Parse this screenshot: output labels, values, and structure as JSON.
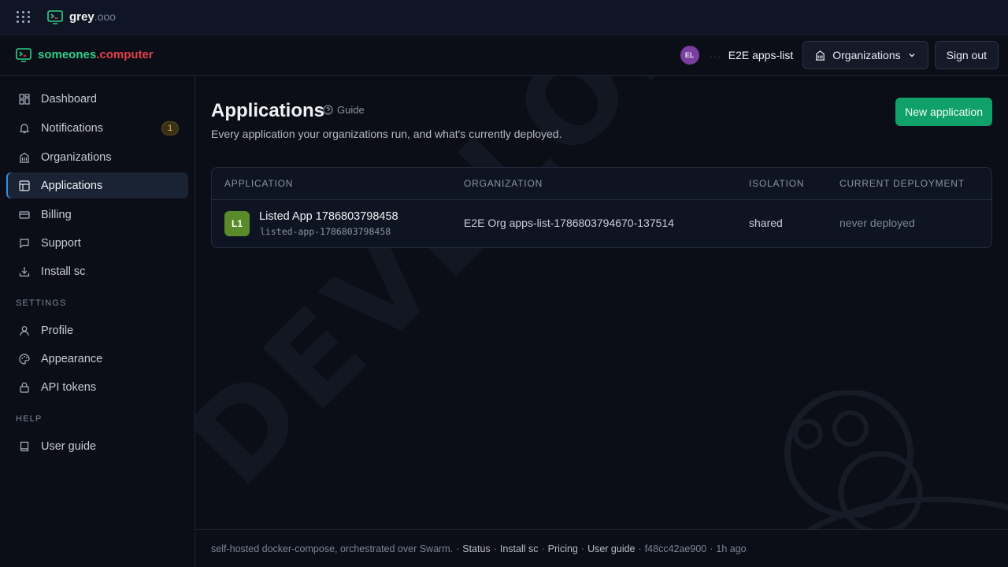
{
  "topbar": {
    "brand": "grey",
    "brand_tld": ".ooo"
  },
  "header": {
    "brand_part1": "someones",
    "brand_part2": ".computer",
    "avatar_initials": "EL",
    "context_dots": "...",
    "context_name": "E2E apps-list",
    "org_button": "Organizations",
    "signout": "Sign out"
  },
  "sidebar": {
    "items": [
      {
        "label": "Dashboard",
        "icon": "dashboard-icon"
      },
      {
        "label": "Notifications",
        "icon": "bell-icon",
        "badge": "1"
      },
      {
        "label": "Organizations",
        "icon": "building-icon"
      },
      {
        "label": "Applications",
        "icon": "layout-icon",
        "active": true
      },
      {
        "label": "Billing",
        "icon": "credit-card-icon"
      },
      {
        "label": "Support",
        "icon": "chat-icon"
      },
      {
        "label": "Install sc",
        "icon": "download-icon"
      }
    ],
    "settings_title": "SETTINGS",
    "settings_items": [
      {
        "label": "Profile",
        "icon": "user-icon"
      },
      {
        "label": "Appearance",
        "icon": "palette-icon"
      },
      {
        "label": "API tokens",
        "icon": "lock-icon"
      }
    ],
    "help_title": "HELP",
    "help_items": [
      {
        "label": "User guide",
        "icon": "book-icon"
      }
    ]
  },
  "main": {
    "title": "Applications",
    "guide": "Guide",
    "subtitle": "Every application your organizations run, and what's currently deployed.",
    "new_button": "New application",
    "watermark": "DEVELOPMENT",
    "table": {
      "headers": [
        "APPLICATION",
        "ORGANIZATION",
        "ISOLATION",
        "CURRENT DEPLOYMENT"
      ],
      "rows": [
        {
          "icon_text": "L1",
          "name": "Listed App 1786803798458",
          "slug": "listed-app-1786803798458",
          "organization": "E2E Org apps-list-1786803794670-137514",
          "isolation": "shared",
          "deployment": "never deployed"
        }
      ]
    }
  },
  "footer": {
    "text": "self-hosted docker-compose, orchestrated over Swarm.",
    "links": [
      "Status",
      "Install sc",
      "Pricing",
      "User guide"
    ],
    "commit": "f48cc42ae900",
    "age": "1h ago",
    "sep": "·"
  },
  "colors": {
    "accent_green": "#10a06a",
    "brand_green": "#2fcf86",
    "brand_red": "#e2404b",
    "active_bar": "#3a8dd8"
  }
}
